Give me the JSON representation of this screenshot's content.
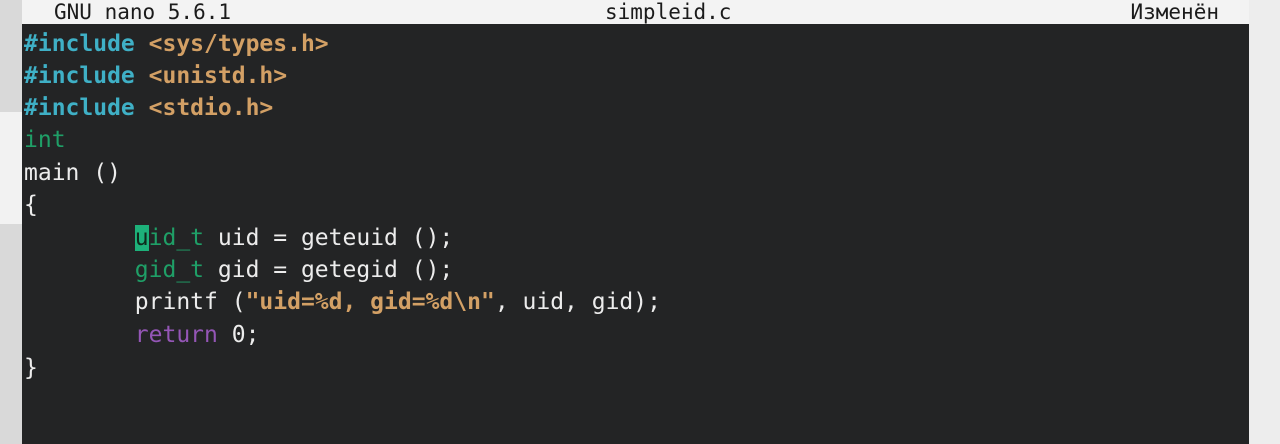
{
  "title_bar": {
    "app_version": "GNU nano 5.6.1",
    "filename": "simpleid.c",
    "status": "Изменён"
  },
  "code": {
    "line1_directive": "#include",
    "line1_header": "<sys/types.h>",
    "line2_directive": "#include",
    "line2_header": "<unistd.h>",
    "line3_directive": "#include",
    "line3_header": "<stdio.h>",
    "line4_type": "int",
    "line5_text": "main ()",
    "line6_text": "{",
    "line7_indent": "        ",
    "line7_cursor_char": "u",
    "line7_type_rest": "id_t",
    "line7_rest": " uid = geteuid ();",
    "line8_indent": "        ",
    "line8_type": "gid_t",
    "line8_rest": " gid = getegid ();",
    "line9_indent": "        ",
    "line9_func": "printf (",
    "line9_string": "\"uid=%d, gid=%d\\n\"",
    "line9_rest": ", uid, gid);",
    "line10_indent": "        ",
    "line10_keyword": "return",
    "line10_rest": " 0;",
    "line11_text": "}"
  },
  "colors": {
    "background": "#232425",
    "titlebar": "#f3f3f3",
    "preprocessor": "#3fb0c6",
    "include_path": "#d3a065",
    "type": "#1f9f67",
    "keyword": "#9456b6",
    "string": "#d3a065",
    "cursor": "#1db17a"
  }
}
